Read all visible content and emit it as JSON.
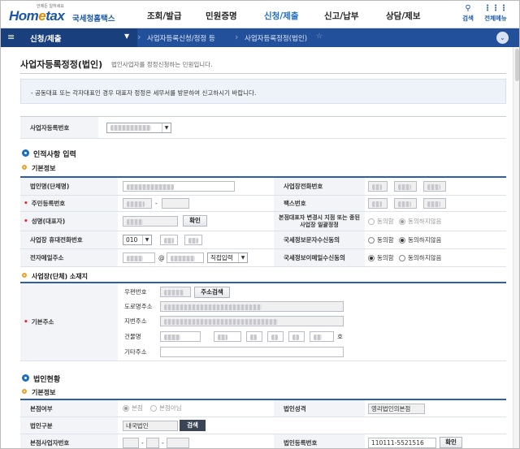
{
  "header": {
    "logo_tagline": "언제든 일하세요",
    "logo_brand": "Hometax",
    "logo_org": "국세청홈택스",
    "menu": [
      "조회/발급",
      "민원증명",
      "신청/제출",
      "신고/납부",
      "상담/제보"
    ],
    "active_menu": "신청/제출",
    "search_label": "검색",
    "all_menu_label": "전체메뉴"
  },
  "navbar": {
    "section": "신청/제출",
    "crumb1": "사업자등록신청/정정 등",
    "crumb2": "사업자등록정정(법인)"
  },
  "page": {
    "title": "사업자등록정정(법인)",
    "subtitle": "법인사업자를 정정신청하는 민원입니다.",
    "notice": "- 공동대표 또는 각자대표인 경우 대표자 정정은 세무서를 방문하여 신고하시기 바랍니다."
  },
  "bizno_row": {
    "label": "사업자등록번호"
  },
  "personal": {
    "section_title": "인적사항 입력",
    "sub_title": "기본정보",
    "corp_name_label": "법인명(단체명)",
    "biz_phone_label": "사업장전화번호",
    "resident_no_label": "주민등록번호",
    "fax_label": "팩스번호",
    "name_label": "성명(대표자)",
    "confirm_btn": "확인",
    "hq_label": "본점대표자 변경시 지점 또는 종된사업장 일괄정정",
    "agree": "동의함",
    "disagree": "동의하지않음",
    "mobile_label": "사업장 휴대전화번호",
    "mobile_prefix": "010",
    "sms_label": "국세정보문자수신동의",
    "email_label": "전자메일주소",
    "email_at": "@",
    "email_direct": "직접입력",
    "email_consent_label": "국세정보이메일수신동의"
  },
  "address": {
    "sub_title": "사업장(단체) 소재지",
    "label": "기본주소",
    "postcode_label": "우편번호",
    "search_btn": "주소검색",
    "road_label": "도로명주소",
    "lot_label": "지번주소",
    "building_label": "건물명",
    "etc_label": "기타주소",
    "ho": "호"
  },
  "corp": {
    "section_title": "법인현황",
    "sub_title": "기본정보",
    "hq_label": "본점여부",
    "hq_yes": "본점",
    "hq_no": "본점아님",
    "nature_label": "법인성격",
    "nature_value": "영리법인의본점",
    "kind_label": "법인구분",
    "kind_value": "내국법인",
    "kind_btn": "검색",
    "hq_bizno_label": "본점사업자번호",
    "regno_label": "법인등록번호",
    "regno_value": "110111-5521516",
    "regno_btn": "확인"
  }
}
